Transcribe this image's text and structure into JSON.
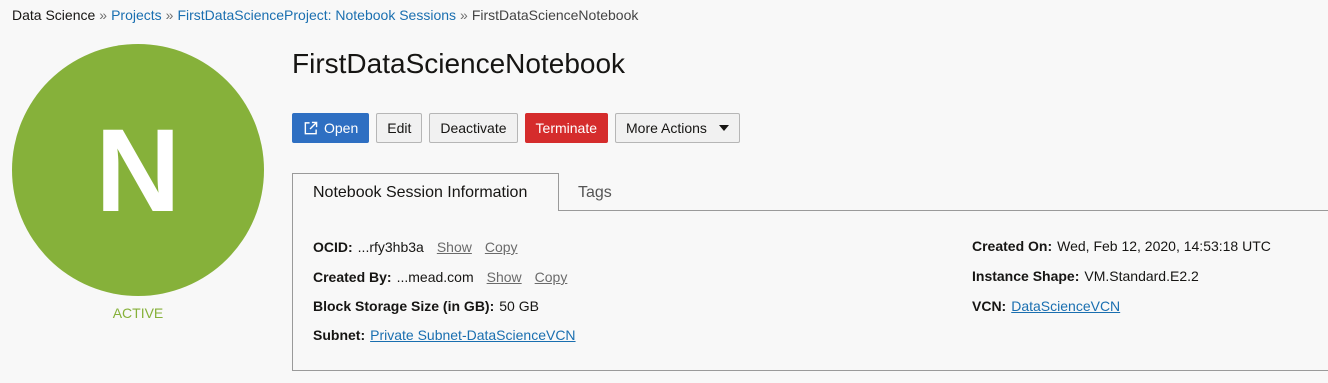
{
  "breadcrumb": {
    "root": "Data Science",
    "separator": "»",
    "projects": "Projects",
    "sessions": "FirstDataScienceProject: Notebook Sessions",
    "current": "FirstDataScienceNotebook"
  },
  "avatar": {
    "letter": "N",
    "color": "#86b13a"
  },
  "status": {
    "text": "ACTIVE",
    "color": "#86b13a"
  },
  "page_title": "FirstDataScienceNotebook",
  "actions": {
    "open": "Open",
    "open_icon": "external-link-icon",
    "edit": "Edit",
    "deactivate": "Deactivate",
    "terminate": "Terminate",
    "more": "More Actions",
    "more_icon": "caret-down-icon"
  },
  "colors": {
    "primary": "#2e6fc2",
    "danger": "#d52c2c",
    "link": "#1a6fb0"
  },
  "tabs": [
    {
      "label": "Notebook Session Information",
      "active": true
    },
    {
      "label": "Tags",
      "active": false
    }
  ],
  "info": {
    "ocid": {
      "label": "OCID:",
      "value": "...rfy3hb3a",
      "show": "Show",
      "copy": "Copy"
    },
    "created_by": {
      "label": "Created By:",
      "value": "...mead.com",
      "show": "Show",
      "copy": "Copy"
    },
    "block_storage": {
      "label": "Block Storage Size (in GB):",
      "value": "50 GB"
    },
    "subnet": {
      "label": "Subnet:",
      "value": "Private Subnet-DataScienceVCN"
    },
    "created_on": {
      "label": "Created On:",
      "value": "Wed, Feb 12, 2020, 14:53:18 UTC"
    },
    "instance_shape": {
      "label": "Instance Shape:",
      "value": "VM.Standard.E2.2"
    },
    "vcn": {
      "label": "VCN:",
      "value": "DataScienceVCN"
    }
  }
}
